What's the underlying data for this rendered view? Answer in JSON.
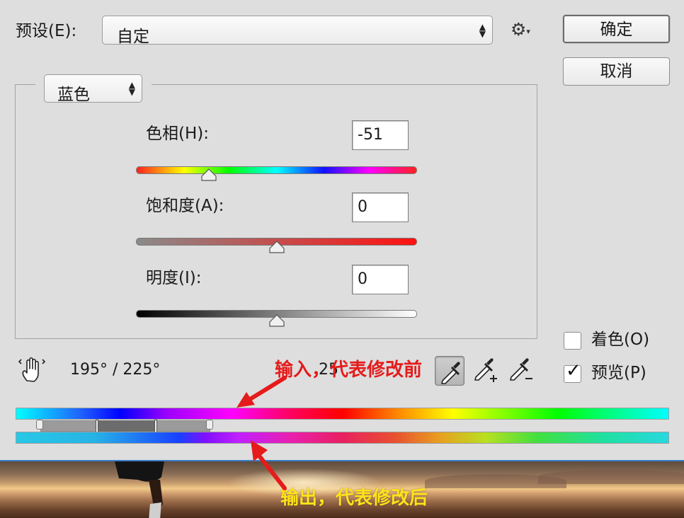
{
  "preset": {
    "label": "预设(E):",
    "value": "自定"
  },
  "buttons": {
    "ok": "确定",
    "cancel": "取消"
  },
  "channel": {
    "value": "蓝色"
  },
  "hue": {
    "label": "色相(H):",
    "value": "-51",
    "slider_fraction": 0.26
  },
  "saturation": {
    "label": "饱和度(A):",
    "value": "0",
    "slider_fraction": 0.5
  },
  "lightness": {
    "label": "明度(I):",
    "value": "0",
    "slider_fraction": 0.5
  },
  "range": {
    "start": "195°",
    "separator": "/",
    "end": "225°",
    "partial": "25"
  },
  "colorize": {
    "label": "着色(O)",
    "checked": false
  },
  "preview": {
    "label": "预览(P)",
    "checked": true
  },
  "annotations": {
    "input": "输入，代表修改前",
    "output": "输出，代表修改后"
  },
  "colors": {
    "annotation_input": "#e51b1b",
    "annotation_output": "#ffe31a"
  },
  "icons": [
    "updown-arrows-icon",
    "gear-icon",
    "hand-adjust-icon",
    "eyedropper-icon",
    "eyedropper-plus-icon",
    "eyedropper-minus-icon",
    "checkmark-icon"
  ]
}
